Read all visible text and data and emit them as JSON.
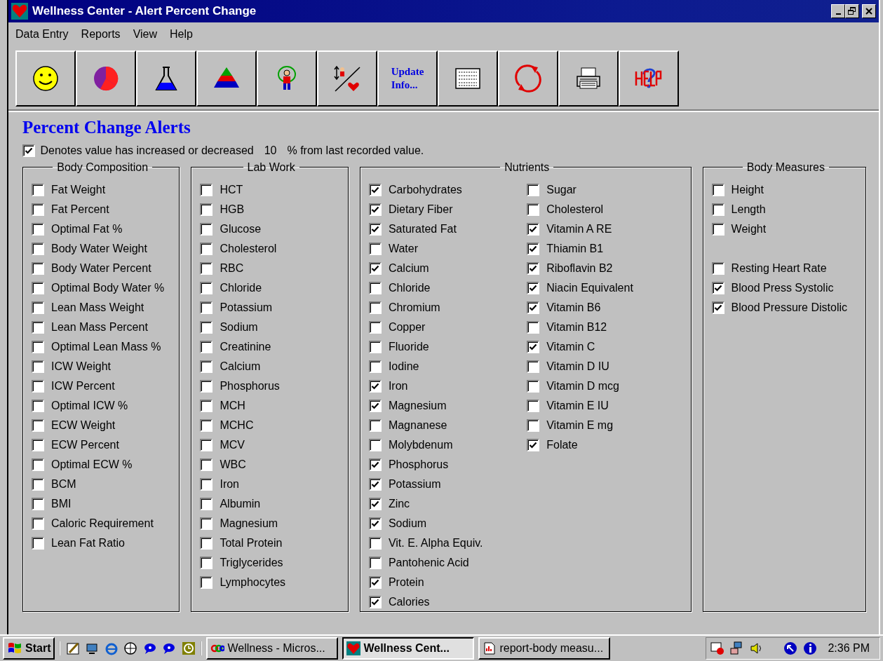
{
  "window": {
    "title": "Wellness Center - Alert Percent Change"
  },
  "menu": [
    "Data Entry",
    "Reports",
    "View",
    "Help"
  ],
  "toolbar": [
    {
      "kind": "smiley"
    },
    {
      "kind": "pie"
    },
    {
      "kind": "flask"
    },
    {
      "kind": "pyramid"
    },
    {
      "kind": "figure"
    },
    {
      "kind": "scale"
    },
    {
      "kind": "text",
      "lines": [
        "Update",
        "Info..."
      ]
    },
    {
      "kind": "grid"
    },
    {
      "kind": "refresh"
    },
    {
      "kind": "printer"
    },
    {
      "kind": "help"
    }
  ],
  "heading": "Percent Change Alerts",
  "legend": {
    "checked": true,
    "text": "Denotes value has increased or decreased",
    "threshold": "10",
    "suffix": "% from last recorded value."
  },
  "groups": [
    {
      "title": "Body Composition",
      "kind": "single",
      "lists": [
        [
          {
            "label": "Fat Weight",
            "checked": false
          },
          {
            "label": "Fat Percent",
            "checked": false
          },
          {
            "label": "Optimal Fat %",
            "checked": false
          },
          {
            "label": "Body Water Weight",
            "checked": false
          },
          {
            "label": "Body Water Percent",
            "checked": false
          },
          {
            "label": "Optimal Body Water %",
            "checked": false
          },
          {
            "label": "Lean Mass Weight",
            "checked": false
          },
          {
            "label": "Lean Mass Percent",
            "checked": false
          },
          {
            "label": "Optimal Lean Mass %",
            "checked": false
          },
          {
            "label": "ICW Weight",
            "checked": false
          },
          {
            "label": "ICW Percent",
            "checked": false
          },
          {
            "label": "Optimal ICW %",
            "checked": false
          },
          {
            "label": "ECW Weight",
            "checked": false
          },
          {
            "label": "ECW Percent",
            "checked": false
          },
          {
            "label": "Optimal ECW %",
            "checked": false
          },
          {
            "label": "BCM",
            "checked": false
          },
          {
            "label": "BMI",
            "checked": false
          },
          {
            "label": "Caloric Requirement",
            "checked": false
          },
          {
            "label": "Lean Fat Ratio",
            "checked": false
          }
        ]
      ]
    },
    {
      "title": "Lab Work",
      "kind": "single",
      "lists": [
        [
          {
            "label": "HCT",
            "checked": false
          },
          {
            "label": "HGB",
            "checked": false
          },
          {
            "label": "Glucose",
            "checked": false
          },
          {
            "label": "Cholesterol",
            "checked": false
          },
          {
            "label": "RBC",
            "checked": false
          },
          {
            "label": "Chloride",
            "checked": false
          },
          {
            "label": "Potassium",
            "checked": false
          },
          {
            "label": "Sodium",
            "checked": false
          },
          {
            "label": "Creatinine",
            "checked": false
          },
          {
            "label": "Calcium",
            "checked": false
          },
          {
            "label": "Phosphorus",
            "checked": false
          },
          {
            "label": "MCH",
            "checked": false
          },
          {
            "label": "MCHC",
            "checked": false
          },
          {
            "label": "MCV",
            "checked": false
          },
          {
            "label": "WBC",
            "checked": false
          },
          {
            "label": "Iron",
            "checked": false
          },
          {
            "label": "Albumin",
            "checked": false
          },
          {
            "label": "Magnesium",
            "checked": false
          },
          {
            "label": "Total Protein",
            "checked": false
          },
          {
            "label": "Triglycerides",
            "checked": false
          },
          {
            "label": "Lymphocytes",
            "checked": false
          }
        ]
      ]
    },
    {
      "title": "Nutrients",
      "kind": "columns",
      "lists": [
        [
          {
            "label": "Carbohydrates",
            "checked": true
          },
          {
            "label": "Dietary Fiber",
            "checked": true
          },
          {
            "label": "Saturated Fat",
            "checked": true
          },
          {
            "label": "Water",
            "checked": false
          },
          {
            "label": "Calcium",
            "checked": true
          },
          {
            "label": "Chloride",
            "checked": false
          },
          {
            "label": "Chromium",
            "checked": false
          },
          {
            "label": "Copper",
            "checked": false
          },
          {
            "label": "Fluoride",
            "checked": false
          },
          {
            "label": "Iodine",
            "checked": false
          },
          {
            "label": "Iron",
            "checked": true
          },
          {
            "label": "Magnesium",
            "checked": true
          },
          {
            "label": "Magnanese",
            "checked": false
          },
          {
            "label": "Molybdenum",
            "checked": false
          },
          {
            "label": "Phosphorus",
            "checked": true
          },
          {
            "label": "Potassium",
            "checked": true
          },
          {
            "label": "Zinc",
            "checked": true
          },
          {
            "label": "Sodium",
            "checked": true
          },
          {
            "label": "Vit. E. Alpha Equiv.",
            "checked": false
          },
          {
            "label": "Pantohenic Acid",
            "checked": false
          },
          {
            "label": "Protein",
            "checked": true
          },
          {
            "label": "Calories",
            "checked": true
          }
        ],
        [
          {
            "label": "Sugar",
            "checked": false
          },
          {
            "label": "Cholesterol",
            "checked": false
          },
          {
            "label": "Vitamin A RE",
            "checked": true
          },
          {
            "label": "Thiamin B1",
            "checked": true
          },
          {
            "label": "Riboflavin B2",
            "checked": true
          },
          {
            "label": "Niacin Equivalent",
            "checked": true
          },
          {
            "label": "Vitamin B6",
            "checked": true
          },
          {
            "label": "Vitamin B12",
            "checked": false
          },
          {
            "label": "Vitamin C",
            "checked": true
          },
          {
            "label": "Vitamin D IU",
            "checked": false
          },
          {
            "label": "Vitamin D mcg",
            "checked": false
          },
          {
            "label": "Vitamin E IU",
            "checked": false
          },
          {
            "label": "Vitamin E mg",
            "checked": false
          },
          {
            "label": "Folate",
            "checked": true
          }
        ]
      ]
    },
    {
      "title": "Body Measures",
      "kind": "stacked",
      "lists": [
        [
          {
            "label": "Height",
            "checked": false
          },
          {
            "label": "Length",
            "checked": false
          },
          {
            "label": "Weight",
            "checked": false
          }
        ],
        [
          {
            "label": "Resting Heart Rate",
            "checked": false
          },
          {
            "label": "Blood Press Systolic",
            "checked": true
          },
          {
            "label": "Blood Pressure Distolic",
            "checked": true
          }
        ]
      ]
    }
  ],
  "taskbar": {
    "start": "Start",
    "quick_launch": [
      {
        "kind": "pen"
      },
      {
        "kind": "desktop"
      },
      {
        "kind": "browser"
      },
      {
        "kind": "globe"
      },
      {
        "kind": "bubble"
      },
      {
        "kind": "bubble"
      },
      {
        "kind": "clock"
      }
    ],
    "tasks": [
      {
        "label": "Wellness - Micros...",
        "kind": "chain",
        "selected": false
      },
      {
        "label": "Wellness Cent...",
        "kind": "heart",
        "selected": true
      },
      {
        "label": "report-body measu...",
        "kind": "document",
        "selected": false
      }
    ],
    "time": "2:36 PM"
  }
}
